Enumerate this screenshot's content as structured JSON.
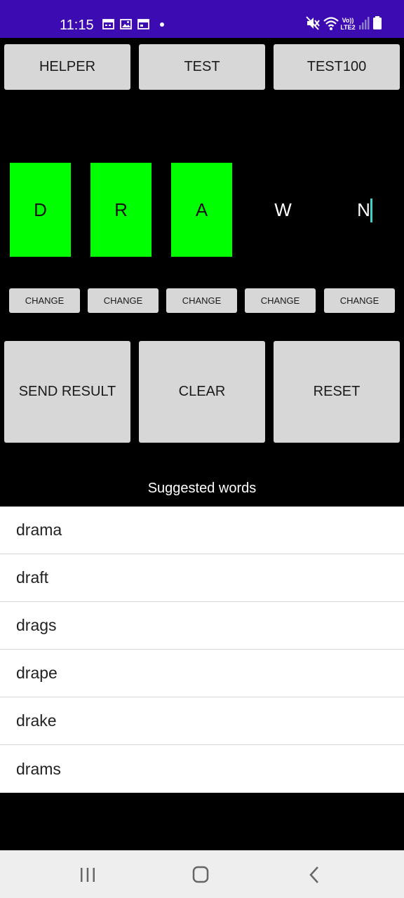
{
  "status_bar": {
    "time": "11:15",
    "network_label": "LTE2",
    "volte_label": "Vo))",
    "icons": [
      "calendar-icon",
      "gallery-icon",
      "calendar-icon",
      "dot-icon",
      "mute-icon",
      "wifi-icon",
      "signal-icon",
      "battery-icon"
    ],
    "color": "#3d0bb2"
  },
  "top_buttons": [
    {
      "label": "HELPER"
    },
    {
      "label": "TEST"
    },
    {
      "label": "TEST100"
    }
  ],
  "tiles": [
    {
      "letter": "D",
      "state": "green"
    },
    {
      "letter": "R",
      "state": "green"
    },
    {
      "letter": "A",
      "state": "green"
    },
    {
      "letter": "W",
      "state": "blank"
    },
    {
      "letter": "N",
      "state": "blank"
    }
  ],
  "tile_colors": {
    "green": "#00ff00",
    "blank": "#000000"
  },
  "change_buttons": [
    {
      "label": "CHANGE"
    },
    {
      "label": "CHANGE"
    },
    {
      "label": "CHANGE"
    },
    {
      "label": "CHANGE"
    },
    {
      "label": "CHANGE"
    }
  ],
  "action_buttons": [
    {
      "label": "SEND RESULT"
    },
    {
      "label": "CLEAR"
    },
    {
      "label": "RESET"
    }
  ],
  "suggested_title": "Suggested words",
  "suggested_words": [
    "drama",
    "draft",
    "drags",
    "drape",
    "drake",
    "drams"
  ],
  "nav_bar": {
    "icons": [
      "recent-apps-icon",
      "home-icon",
      "back-icon"
    ]
  }
}
